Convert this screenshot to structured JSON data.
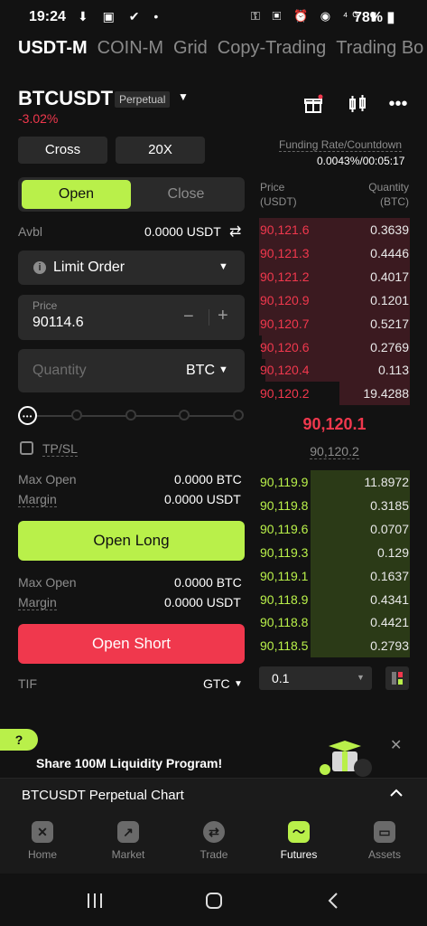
{
  "status_bar": {
    "time": "19:24",
    "left_icons": "⬇ ▣ ✔ •",
    "right_icons": "⚿ ▣ ⏰ ◉ ⁴ᴳ ▮",
    "battery": "78%"
  },
  "tabs": [
    "USDT-M",
    "COIN-M",
    "Grid",
    "Copy-Trading",
    "Trading Bo"
  ],
  "header": {
    "symbol": "BTCUSDT",
    "badge": "Perpetual",
    "change": "-3.02%"
  },
  "margin_mode": {
    "cross_label": "Cross",
    "leverage_label": "20X"
  },
  "funding": {
    "label": "Funding Rate/Countdown",
    "value": "0.0043%/00:05:17"
  },
  "order_type_tabs": {
    "open": "Open",
    "close": "Close"
  },
  "avbl": {
    "label": "Avbl",
    "value": "0.0000 USDT"
  },
  "order_type": {
    "label": "Limit Order"
  },
  "price_field": {
    "label": "Price",
    "value": "90114.6"
  },
  "quantity_field": {
    "placeholder": "Quantity",
    "unit": "BTC"
  },
  "slider": {
    "level": 0
  },
  "tpsl": {
    "label": "TP/SL",
    "checked": false
  },
  "long_info": {
    "max_open_label": "Max Open",
    "max_open_value": "0.0000 BTC",
    "margin_label": "Margin",
    "margin_value": "0.0000 USDT"
  },
  "open_long_label": "Open Long",
  "short_info": {
    "max_open_label": "Max Open",
    "max_open_value": "0.0000 BTC",
    "margin_label": "Margin",
    "margin_value": "0.0000 USDT"
  },
  "open_short_label": "Open Short",
  "tif": {
    "label": "TIF",
    "value": "GTC"
  },
  "order_book": {
    "price_header": "Price",
    "price_unit": "(USDT)",
    "qty_header": "Quantity",
    "qty_unit": "(BTC)",
    "asks": [
      {
        "price": "90,121.6",
        "qty": "0.3639",
        "depth": 1.0
      },
      {
        "price": "90,121.3",
        "qty": "0.4446",
        "depth": 1.0
      },
      {
        "price": "90,121.2",
        "qty": "0.4017",
        "depth": 1.0
      },
      {
        "price": "90,120.9",
        "qty": "0.1201",
        "depth": 1.0
      },
      {
        "price": "90,120.7",
        "qty": "0.5217",
        "depth": 1.0
      },
      {
        "price": "90,120.6",
        "qty": "0.2769",
        "depth": 0.98
      },
      {
        "price": "90,120.4",
        "qty": "0.113",
        "depth": 0.96
      },
      {
        "price": "90,120.2",
        "qty": "19.4288",
        "depth": 0.47
      }
    ],
    "last_price": "90,120.1",
    "mark_price": "90,120.2",
    "bids": [
      {
        "price": "90,119.9",
        "qty": "11.8972",
        "depth": 0.66
      },
      {
        "price": "90,119.8",
        "qty": "0.3185",
        "depth": 0.66
      },
      {
        "price": "90,119.6",
        "qty": "0.0707",
        "depth": 0.66
      },
      {
        "price": "90,119.3",
        "qty": "0.129",
        "depth": 0.66
      },
      {
        "price": "90,119.1",
        "qty": "0.1637",
        "depth": 0.66
      },
      {
        "price": "90,118.9",
        "qty": "0.4341",
        "depth": 0.66
      },
      {
        "price": "90,118.8",
        "qty": "0.4421",
        "depth": 0.66
      },
      {
        "price": "90,118.5",
        "qty": "0.2793",
        "depth": 0.66
      }
    ],
    "precision": "0.1"
  },
  "banner": {
    "badge": "?",
    "title": "Share 100M Liquidity Program!"
  },
  "chart_bar": {
    "label": "BTCUSDT Perpetual Chart"
  },
  "bottom_nav": [
    {
      "label": "Home",
      "icon": "home-icon",
      "glyph": "✕",
      "active": false
    },
    {
      "label": "Market",
      "icon": "market-icon",
      "glyph": "↗",
      "active": false
    },
    {
      "label": "Trade",
      "icon": "trade-icon",
      "glyph": "⇄",
      "active": false
    },
    {
      "label": "Futures",
      "icon": "futures-icon",
      "glyph": "〜",
      "active": true
    },
    {
      "label": "Assets",
      "icon": "assets-icon",
      "glyph": "▭",
      "active": false
    }
  ],
  "colors": {
    "accent_green": "#b9f04a",
    "accent_red": "#f0384d"
  }
}
